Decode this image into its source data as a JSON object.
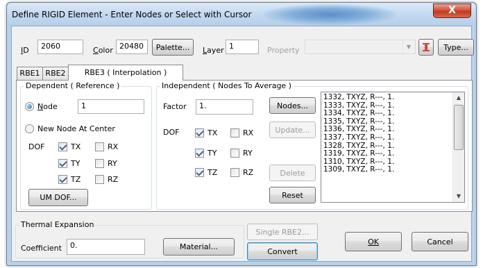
{
  "window": {
    "title": "Define RIGID Element - Enter Nodes or Select with Cursor",
    "close_glyph": "X"
  },
  "top": {
    "id_label": "ID",
    "id_value": "2060",
    "color_label": "Color",
    "color_value": "20480",
    "palette_label": "Palette...",
    "layer_label": "Layer",
    "layer_value": "1",
    "property_label": "Property",
    "property_value": "",
    "type_label": "Type..."
  },
  "tabs": [
    {
      "label": "RBE1",
      "active": false
    },
    {
      "label": "RBE2",
      "active": false
    },
    {
      "label": "RBE3 ( Interpolation )",
      "active": true
    }
  ],
  "dependent": {
    "group_label": "Dependent ( Reference )",
    "node_label": "Node",
    "node_value": "1",
    "new_node_label": "New Node At Center",
    "dof_label": "DOF",
    "dofs": [
      {
        "label": "TX",
        "checked": true
      },
      {
        "label": "RX",
        "checked": false
      },
      {
        "label": "TY",
        "checked": true
      },
      {
        "label": "RY",
        "checked": false
      },
      {
        "label": "TZ",
        "checked": true
      },
      {
        "label": "RZ",
        "checked": false
      }
    ],
    "um_dof_label": "UM DOF..."
  },
  "independent": {
    "group_label": "Independent ( Nodes To Average )",
    "factor_label": "Factor",
    "factor_value": "1.",
    "dof_label": "DOF",
    "dofs": [
      {
        "label": "TX",
        "checked": true
      },
      {
        "label": "RX",
        "checked": false
      },
      {
        "label": "TY",
        "checked": true
      },
      {
        "label": "RY",
        "checked": false
      },
      {
        "label": "TZ",
        "checked": true
      },
      {
        "label": "RZ",
        "checked": false
      }
    ],
    "nodes_label": "Nodes...",
    "update_label": "Update...",
    "delete_label": "Delete",
    "reset_label": "Reset",
    "list": [
      "1332, TXYZ, R---, 1.",
      "1333, TXYZ, R---, 1.",
      "1334, TXYZ, R---, 1.",
      "1335, TXYZ, R---, 1.",
      "1336, TXYZ, R---, 1.",
      "1337, TXYZ, R---, 1.",
      "1328, TXYZ, R---, 1.",
      "1319, TXYZ, R---, 1.",
      "1310, TXYZ, R---, 1.",
      "1309, TXYZ, R---, 1."
    ]
  },
  "thermal": {
    "group_label": "Thermal Expansion",
    "coef_label": "Coefficient",
    "coef_value": "0.",
    "material_label": "Material..."
  },
  "bottom": {
    "single_rbe2_label": "Single RBE2...",
    "convert_label": "Convert",
    "ok_label": "OK",
    "cancel_label": "Cancel"
  }
}
